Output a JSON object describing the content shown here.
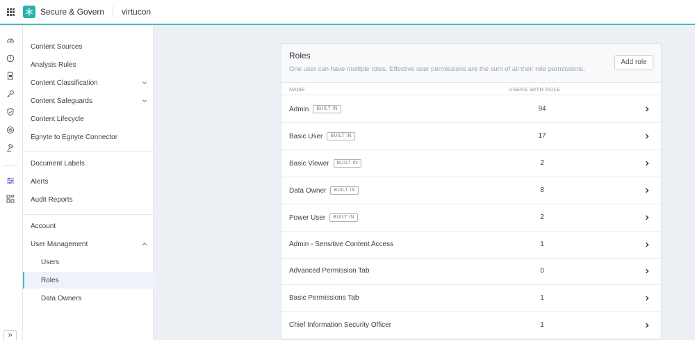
{
  "header": {
    "app_title": "Secure & Govern",
    "tenant": "virtucon"
  },
  "rail": {
    "icons": [
      "dashboard-icon",
      "info-icon",
      "document-icon",
      "key-icon",
      "shield-icon",
      "target-icon",
      "gavel-icon",
      "sliders-icon",
      "apps-icon"
    ],
    "expand_label": "»"
  },
  "nav": {
    "content_sources": "Content Sources",
    "analysis_rules": "Analysis Rules",
    "content_classification": "Content Classification",
    "content_safeguards": "Content Safeguards",
    "content_lifecycle": "Content Lifecycle",
    "egnyte_connector": "Egnyte to Egnyte Connector",
    "document_labels": "Document Labels",
    "alerts": "Alerts",
    "audit_reports": "Audit Reports",
    "account": "Account",
    "user_management": "User Management",
    "users": "Users",
    "roles": "Roles",
    "data_owners": "Data Owners"
  },
  "roles_card": {
    "title": "Roles",
    "subtitle": "One user can have multiple roles. Effective user permissions are the sum of all their role permissions.",
    "add_role_label": "Add role",
    "col_name": "NAME",
    "col_users": "USERS WITH ROLE",
    "badge_label": "BUILT IN",
    "rows": [
      {
        "name": "Admin",
        "builtin": true,
        "count": "94"
      },
      {
        "name": "Basic User",
        "builtin": true,
        "count": "17"
      },
      {
        "name": "Basic Viewer",
        "builtin": true,
        "count": "2"
      },
      {
        "name": "Data Owner",
        "builtin": true,
        "count": "8"
      },
      {
        "name": "Power User",
        "builtin": true,
        "count": "2"
      },
      {
        "name": "Admin - Sensitive Content Access",
        "builtin": false,
        "count": "1"
      },
      {
        "name": "Advanced Permission Tab",
        "builtin": false,
        "count": "0"
      },
      {
        "name": "Basic Permissions Tab",
        "builtin": false,
        "count": "1"
      },
      {
        "name": "Chief Information Security Officer",
        "builtin": false,
        "count": "1"
      }
    ]
  },
  "colors": {
    "accent": "#3fbfb8",
    "brand": "#27b3ab",
    "active_bg": "#eef3fa"
  }
}
